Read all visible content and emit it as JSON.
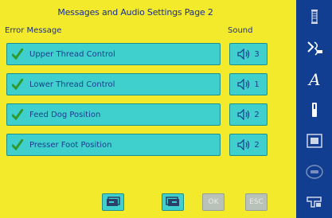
{
  "page": {
    "title": "Messages and Audio Settings Page 2",
    "col_error": "Error Message",
    "col_sound": "Sound"
  },
  "rows": [
    {
      "label": "Upper Thread Control",
      "sound": "3"
    },
    {
      "label": "Lower Thread Control",
      "sound": "1"
    },
    {
      "label": "Feed Dog Position",
      "sound": "2"
    },
    {
      "label": "Presser Foot Position",
      "sound": "2"
    }
  ],
  "bottom": {
    "ok": "OK",
    "esc": "ESC"
  },
  "sidebar_icons": [
    "spool-icon",
    "stitch-icon",
    "letter-a-icon",
    "needle-icon",
    "embroidery-frame-icon",
    "buttonhole-icon",
    "machine-icon"
  ],
  "colors": {
    "background": "#f2ea2a",
    "button": "#3fd0ce",
    "sidebar": "#123e91",
    "text": "#1b3c8c",
    "check": "#2e9a2e"
  }
}
